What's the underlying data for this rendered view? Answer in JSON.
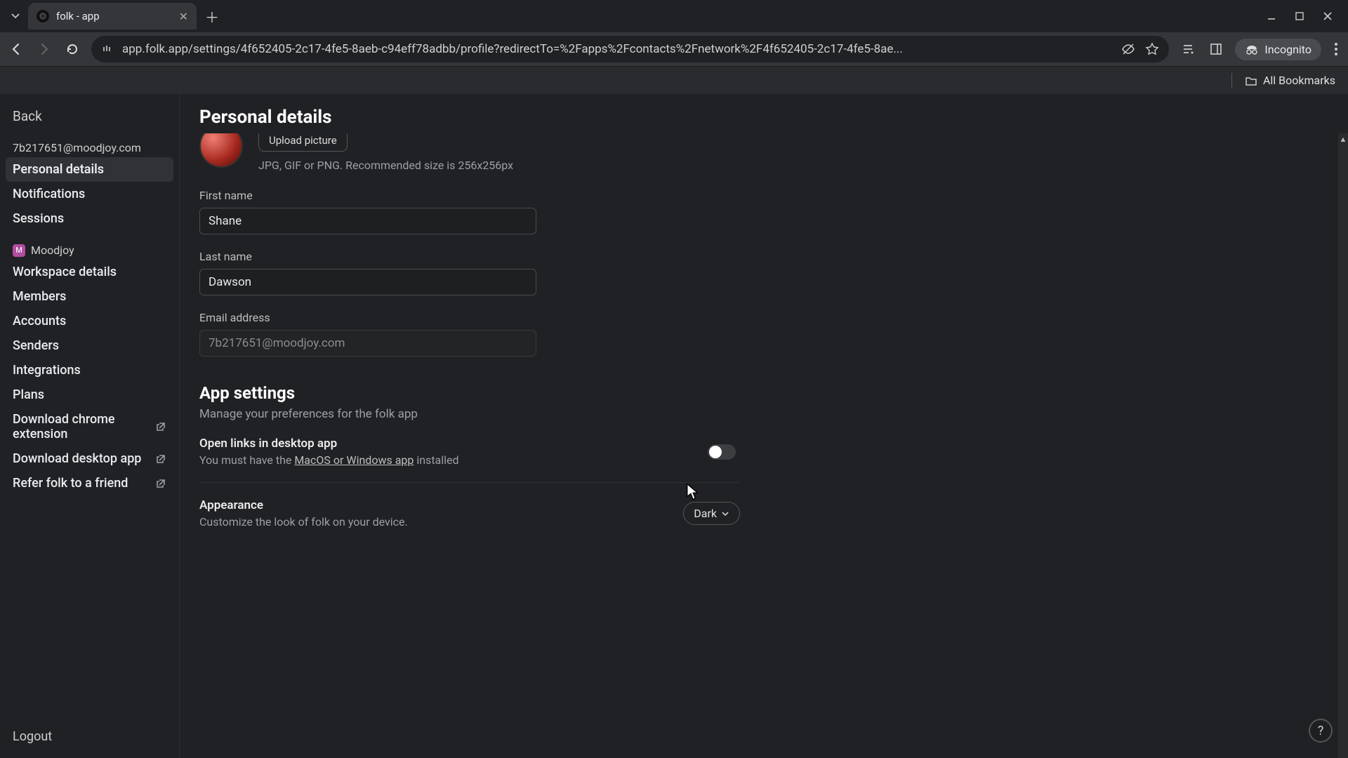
{
  "browser": {
    "tab_title": "folk - app",
    "url": "app.folk.app/settings/4f652405-2c17-4fe5-8aeb-c94eff78adbb/profile?redirectTo=%2Fapps%2Fcontacts%2Fnetwork%2F4f652405-2c17-4fe5-8ae...",
    "incognito_label": "Incognito",
    "all_bookmarks": "All Bookmarks"
  },
  "sidebar": {
    "back": "Back",
    "email": "7b217651@moodjoy.com",
    "personal": {
      "details": "Personal details",
      "notifications": "Notifications",
      "sessions": "Sessions"
    },
    "workspace_name": "Moodjoy",
    "ws_badge": "M",
    "workspace": {
      "details": "Workspace details",
      "members": "Members",
      "accounts": "Accounts",
      "senders": "Senders",
      "integrations": "Integrations",
      "plans": "Plans",
      "chrome_ext": "Download chrome extension",
      "desktop_app": "Download desktop app",
      "refer": "Refer folk to a friend"
    },
    "logout": "Logout"
  },
  "main": {
    "title": "Personal details",
    "upload_button": "Upload picture",
    "upload_hint": "JPG, GIF or PNG. Recommended size is 256x256px",
    "first_name_label": "First name",
    "first_name_value": "Shane",
    "last_name_label": "Last name",
    "last_name_value": "Dawson",
    "email_label": "Email address",
    "email_value": "7b217651@moodjoy.com",
    "app_settings_title": "App settings",
    "app_settings_sub": "Manage your preferences for the folk app",
    "open_links_title": "Open links in desktop app",
    "open_links_prefix": "You must have the ",
    "open_links_link": "MacOS or Windows app",
    "open_links_suffix": " installed",
    "appearance_title": "Appearance",
    "appearance_desc": "Customize the look of folk on your device.",
    "appearance_value": "Dark"
  }
}
